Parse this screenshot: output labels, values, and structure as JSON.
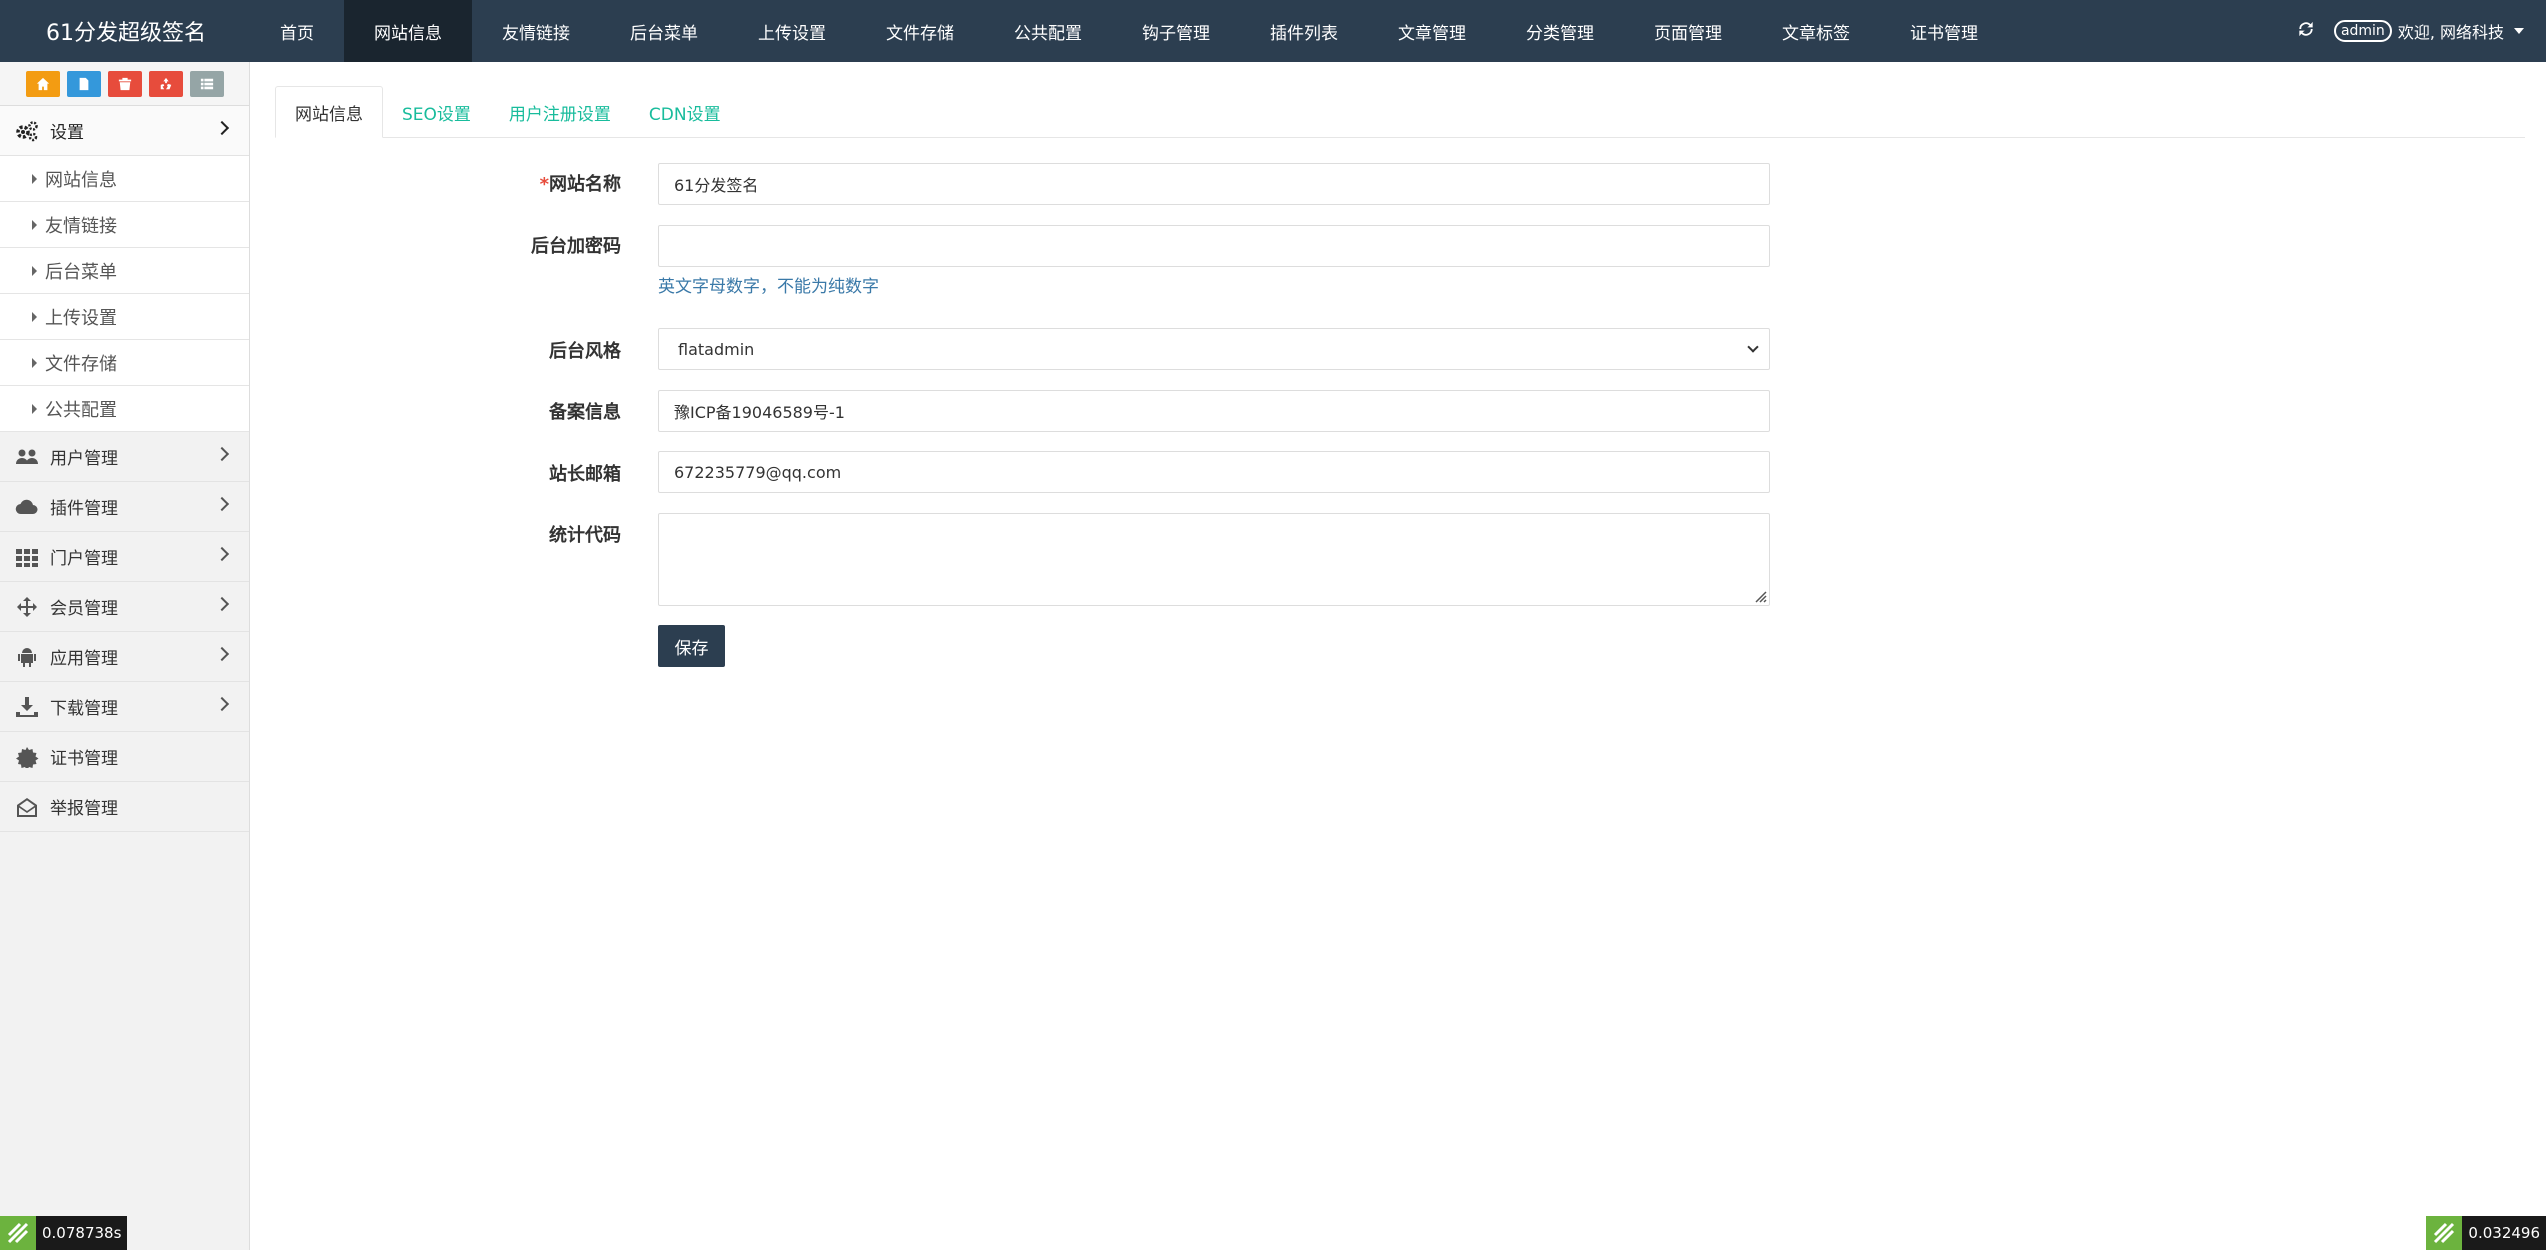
{
  "brand": "61分发超级签名",
  "nav": [
    "首页",
    "网站信息",
    "友情链接",
    "后台菜单",
    "上传设置",
    "文件存储",
    "公共配置",
    "钩子管理",
    "插件列表",
    "文章管理",
    "分类管理",
    "页面管理",
    "文章标签",
    "证书管理"
  ],
  "nav_active": "网站信息",
  "topright": {
    "admin_badge": "admin",
    "welcome": "欢迎, 网络科技"
  },
  "shortcut_colors": [
    "#f39c12",
    "#3498db",
    "#e74c3c",
    "#e74c3c",
    "#95a5a6"
  ],
  "sidebar": {
    "settings": "设置",
    "settings_items": [
      "网站信息",
      "友情链接",
      "后台菜单",
      "上传设置",
      "文件存储",
      "公共配置"
    ],
    "menus": [
      {
        "label": "用户管理",
        "icon": "users-icon",
        "has_arrow": true
      },
      {
        "label": "插件管理",
        "icon": "cloud-icon",
        "has_arrow": true
      },
      {
        "label": "门户管理",
        "icon": "grid-icon",
        "has_arrow": true
      },
      {
        "label": "会员管理",
        "icon": "move-icon",
        "has_arrow": true
      },
      {
        "label": "应用管理",
        "icon": "android-icon",
        "has_arrow": true
      },
      {
        "label": "下载管理",
        "icon": "download-icon",
        "has_arrow": true
      },
      {
        "label": "证书管理",
        "icon": "certificate-icon",
        "has_arrow": false
      },
      {
        "label": "举报管理",
        "icon": "envelope-open-icon",
        "has_arrow": false
      }
    ]
  },
  "tabs": [
    "网站信息",
    "SEO设置",
    "用户注册设置",
    "CDN设置"
  ],
  "form": {
    "site_name_label": "网站名称",
    "site_name_value": "61分发签名",
    "admin_code_label": "后台加密码",
    "admin_code_value": "",
    "admin_code_hint": "英文字母数字，不能为纯数字",
    "admin_style_label": "后台风格",
    "admin_style_value": "flatadmin",
    "icp_label": "备案信息",
    "icp_value": "豫ICP备19046589号-1",
    "email_label": "站长邮箱",
    "email_value": "672235779@qq.com",
    "stats_label": "统计代码",
    "stats_value": "",
    "save_label": "保存"
  },
  "timings": {
    "left": "0.078738s",
    "right": "0.032496"
  },
  "colors": {
    "topbar": "#2c3e50",
    "topbar_active": "#1a252f",
    "tab_link": "#18bc9c",
    "hint": "#3a79a8",
    "badge_green": "#6cb33e"
  }
}
